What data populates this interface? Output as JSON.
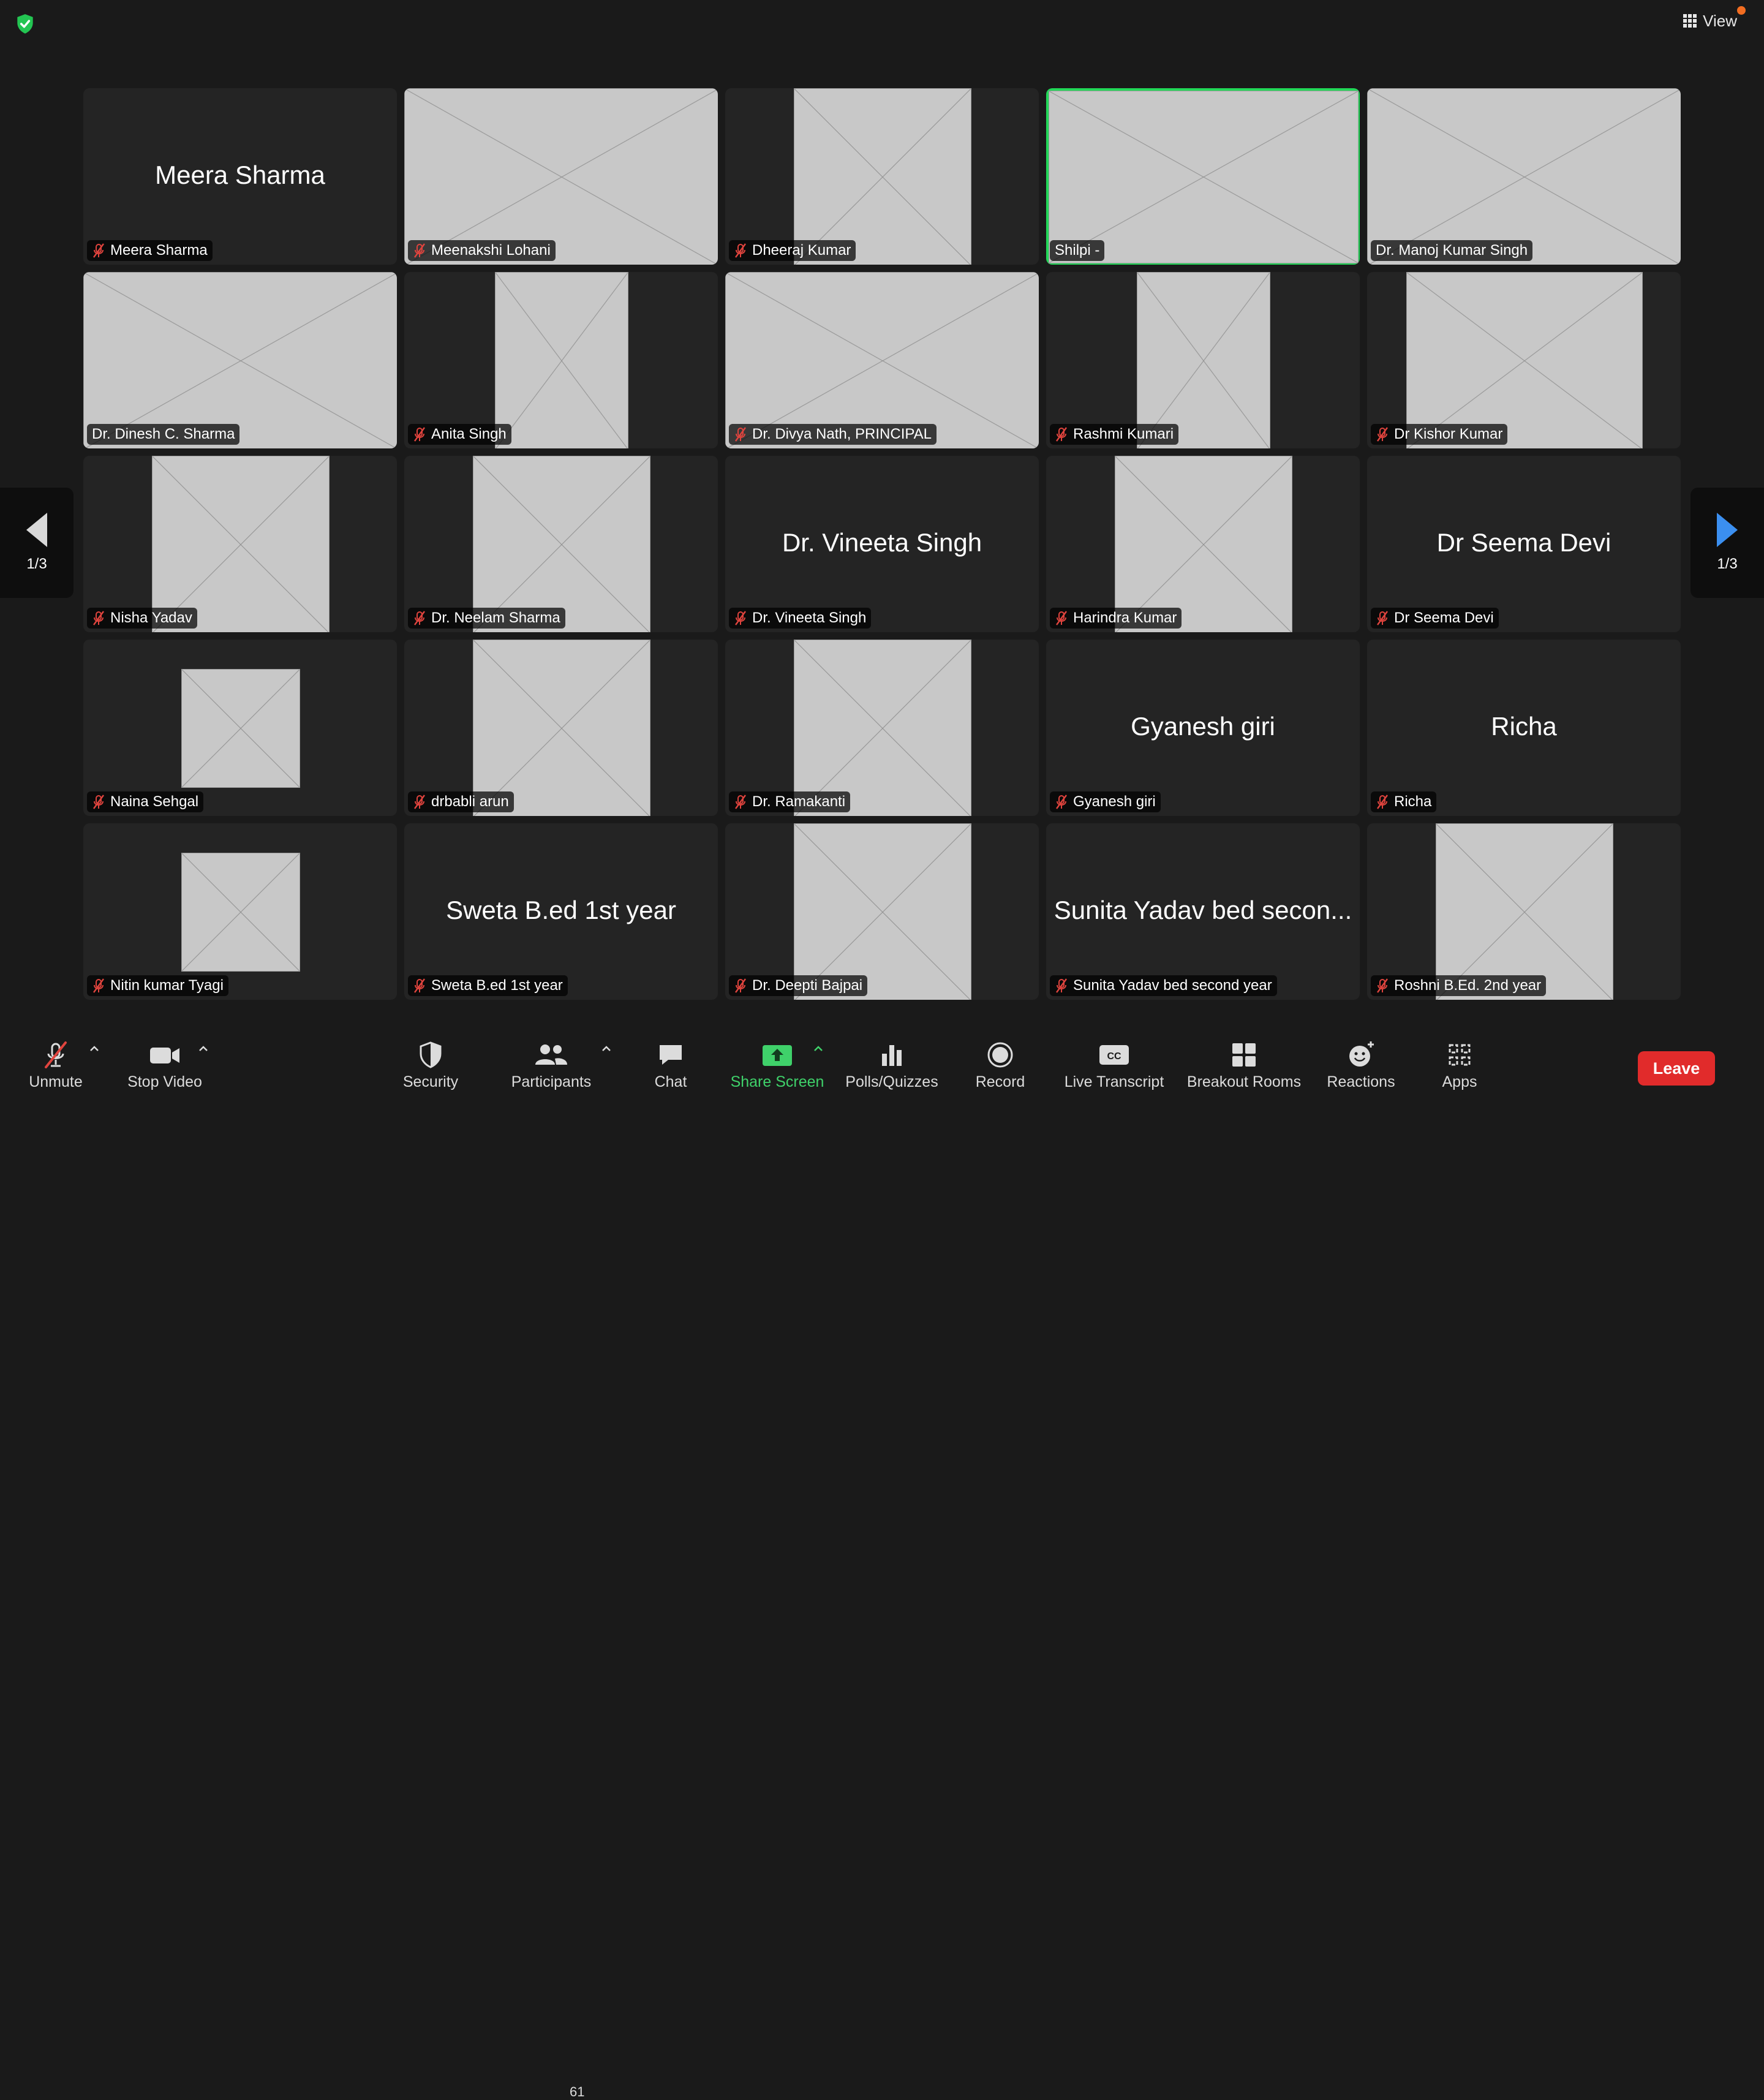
{
  "header": {
    "view_label": "View"
  },
  "pager": {
    "left_label": "1/3",
    "right_label": "1/3"
  },
  "participants": [
    {
      "name": "Meera Sharma",
      "display": "Meera Sharma",
      "video": false,
      "muted": true
    },
    {
      "name": "Meenakshi Lohani",
      "video": true,
      "muted": true
    },
    {
      "name": "Dheeraj Kumar",
      "video": true,
      "muted": true
    },
    {
      "name": "Shilpi -",
      "video": true,
      "muted": false,
      "active_speaker": true
    },
    {
      "name": "Dr. Manoj Kumar Singh",
      "video": true,
      "muted": false
    },
    {
      "name": "Dr.  Dinesh C. Sharma",
      "video": true,
      "muted": false
    },
    {
      "name": "Anita Singh",
      "video": true,
      "muted": true
    },
    {
      "name": "Dr. Divya Nath, PRINCIPAL",
      "video": true,
      "muted": true
    },
    {
      "name": "Rashmi Kumari",
      "video": true,
      "muted": true
    },
    {
      "name": "Dr Kishor Kumar",
      "video": true,
      "muted": true
    },
    {
      "name": "Nisha Yadav",
      "video": true,
      "muted": true
    },
    {
      "name": "Dr. Neelam Sharma",
      "video": true,
      "muted": true
    },
    {
      "name": "Dr. Vineeta Singh",
      "display": "Dr. Vineeta Singh",
      "video": false,
      "muted": true
    },
    {
      "name": "Harindra Kumar",
      "video": true,
      "muted": true
    },
    {
      "name": "Dr Seema Devi",
      "display": "Dr Seema Devi",
      "video": false,
      "muted": true
    },
    {
      "name": "Naina Sehgal",
      "video": true,
      "muted": true
    },
    {
      "name": "drbabli arun",
      "video": true,
      "muted": true
    },
    {
      "name": "Dr. Ramakanti",
      "video": true,
      "muted": true
    },
    {
      "name": "Gyanesh giri",
      "display": "Gyanesh giri",
      "video": false,
      "muted": true
    },
    {
      "name": "Richa",
      "display": "Richa",
      "video": false,
      "muted": true
    },
    {
      "name": "Nitin kumar Tyagi",
      "video": true,
      "muted": true
    },
    {
      "name": "Sweta B.ed 1st year",
      "display": "Sweta B.ed 1st year",
      "video": false,
      "muted": true
    },
    {
      "name": "Dr. Deepti Bajpai",
      "video": true,
      "muted": true
    },
    {
      "name": "Sunita Yadav bed second year",
      "display": "Sunita Yadav bed secon...",
      "video": false,
      "muted": true
    },
    {
      "name": "Roshni B.Ed. 2nd year",
      "video": true,
      "muted": true
    }
  ],
  "toolbar": {
    "unmute": "Unmute",
    "stop_video": "Stop Video",
    "security": "Security",
    "participants": "Participants",
    "participants_count": "61",
    "chat": "Chat",
    "share_screen": "Share Screen",
    "polls": "Polls/Quizzes",
    "record": "Record",
    "live_transcript": "Live Transcript",
    "breakout_rooms": "Breakout Rooms",
    "reactions": "Reactions",
    "apps": "Apps",
    "leave": "Leave"
  },
  "colors": {
    "active_speaker_border": "#23d959",
    "share_screen": "#3fd16a",
    "leave": "#e12b2b",
    "muted_icon": "#e0443e",
    "pager_arrow_right": "#3b8ff0"
  }
}
